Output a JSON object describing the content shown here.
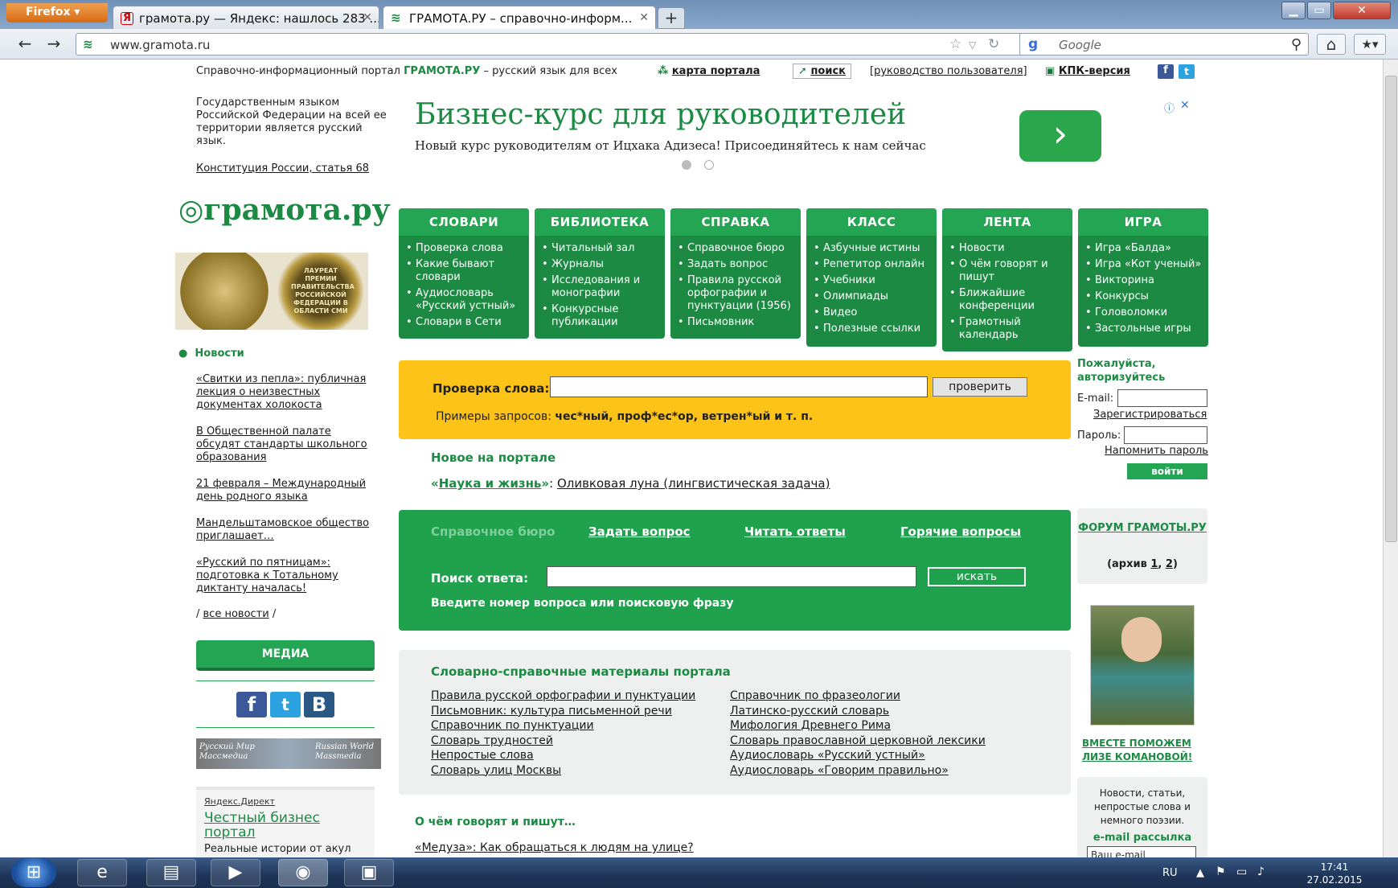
{
  "browser": {
    "app_button": "Firefox",
    "tabs": [
      {
        "label": "грамота.ру — Яндекс: нашлось 283 ..."
      },
      {
        "label": "ГРАМОТА.РУ – справочно-информ..."
      }
    ],
    "url": "www.gramota.ru",
    "search_placeholder": "Google",
    "colors": {
      "tabbar": "#7e9cc2",
      "firefox_button": "#e07e22"
    }
  },
  "header": {
    "tagline_prefix": "Справочно-информационный портал",
    "tagline_brand": "ГРАМОТА.РУ",
    "tagline_suffix": "– русский язык для всех",
    "sitemap": "карта портала",
    "search": "поиск",
    "guide": "[руководство пользователя]",
    "kpk": "КПК-версия"
  },
  "left": {
    "constitution_text": "Государственным языком Российской Федерации на всей ее территории является русский язык.",
    "constitution_link": "Конституция России, статья 68",
    "logo": "грамота.ру",
    "medal_text": "ЛАУРЕАТ ПРЕМИИ ПРАВИТЕЛЬСТВА РОССИЙСКОЙ ФЕДЕРАЦИИ В ОБЛАСТИ СМИ",
    "news_title": "Новости",
    "news": [
      "«Свитки из пепла»: публичная лекция о неизвестных документах холокоста",
      "В Общественной палате обсудят стандарты школьного образования",
      "21 февраля – Международный день родного языка",
      "Мандельштамовское общество приглашает…",
      "«Русский по пятницам»: подготовка к Тотальному диктанту началась!"
    ],
    "all_news": "все новости",
    "media": "МЕДИА",
    "rw_left": "Русский Мир Массмедиа",
    "rw_right": "Russian World Massmedia",
    "direct_label": "Яндекс.Директ",
    "direct_title": "Честный бизнес портал",
    "direct_text": "Реальные истории от акул"
  },
  "ad": {
    "title": "Бизнес-курс для руководителей",
    "text": "Новый курс руководителям от Ицхака Адизеса! Присоединяйтесь к нам сейчас",
    "arrow": "›"
  },
  "menu": [
    {
      "title": "СЛОВАРИ",
      "items": [
        "Проверка слова",
        "Какие бывают словари",
        "Аудиословарь «Русский устный»",
        "Словари в Сети"
      ]
    },
    {
      "title": "БИБЛИОТЕКА",
      "items": [
        "Читальный зал",
        "Журналы",
        "Исследования и монографии",
        "Конкурсные публикации"
      ]
    },
    {
      "title": "СПРАВКА",
      "items": [
        "Справочное бюро",
        "Задать вопрос",
        "Правила русской орфографии и пунктуации (1956)",
        "Письмовник"
      ]
    },
    {
      "title": "КЛАСС",
      "items": [
        "Азбучные истины",
        "Репетитор онлайн",
        "Учебники",
        "Олимпиады",
        "Видео",
        "Полезные ссылки"
      ]
    },
    {
      "title": "ЛЕНТА",
      "items": [
        "Новости",
        "О чём говорят и пишут",
        "Ближайшие конференции",
        "Грамотный календарь"
      ]
    },
    {
      "title": "ИГРА",
      "items": [
        "Игра «Балда»",
        "Игра «Кот ученый»",
        "Викторина",
        "Конкурсы",
        "Головоломки",
        "Застольные игры"
      ]
    }
  ],
  "check": {
    "label": "Проверка слова:",
    "button": "проверить",
    "examples_prefix": "Примеры запросов:",
    "examples": "чес*ный, проф*ес*ор, ветрен*ый и т. п."
  },
  "new_on_portal": {
    "title": "Новое на портале",
    "source": "Наука и жизнь",
    "text": "Оливковая луна (лингвистическая задача)"
  },
  "bureau": {
    "tabs": [
      "Справочное бюро",
      "Задать вопрос",
      "Читать ответы",
      "Горячие вопросы"
    ],
    "search_label": "Поиск ответа:",
    "button": "искать",
    "hint": "Введите номер вопроса или поисковую фразу"
  },
  "materials": {
    "title": "Словарно-справочные материалы портала",
    "left": [
      "Правила русской орфографии и пунктуации",
      "Письмовник: культура письменной речи",
      "Справочник по пунктуации",
      "Словарь трудностей",
      "Непростые слова",
      "Словарь улиц Москвы"
    ],
    "right": [
      "Справочник по фразеологии",
      "Латинско-русский словарь",
      "Мифология Древнего Рима",
      "Словарь православной церковной лексики",
      "Аудиословарь «Русский устный»",
      "Аудиословарь «Говорим правильно»"
    ]
  },
  "talk": {
    "title": "О чём говорят и пишут…",
    "item": "«Медуза»: Как обращаться к людям на улице?"
  },
  "right": {
    "login_title": "Пожалуйста, авторизуйтесь",
    "email_label": "E-mail:",
    "register": "Зарегистрироваться",
    "password_label": "Пароль:",
    "remind": "Напомнить пароль",
    "login_button": "войти",
    "forum": "ФОРУМ ГРАМОТЫ.РУ",
    "archive_prefix": "(архив",
    "archive_1": "1",
    "archive_2": "2",
    "help": "ВМЕСТЕ ПОМОЖЕМ ЛИЗЕ КОМАНОВОЙ!",
    "subscribe_text": "Новости, статьи, непростые слова и немного поэзии.",
    "subscribe_title": "e-mail рассылка",
    "subscribe_placeholder": "Ваш e-mail"
  },
  "taskbar": {
    "lang": "RU",
    "time": "17:41",
    "date": "27.02.2015"
  }
}
